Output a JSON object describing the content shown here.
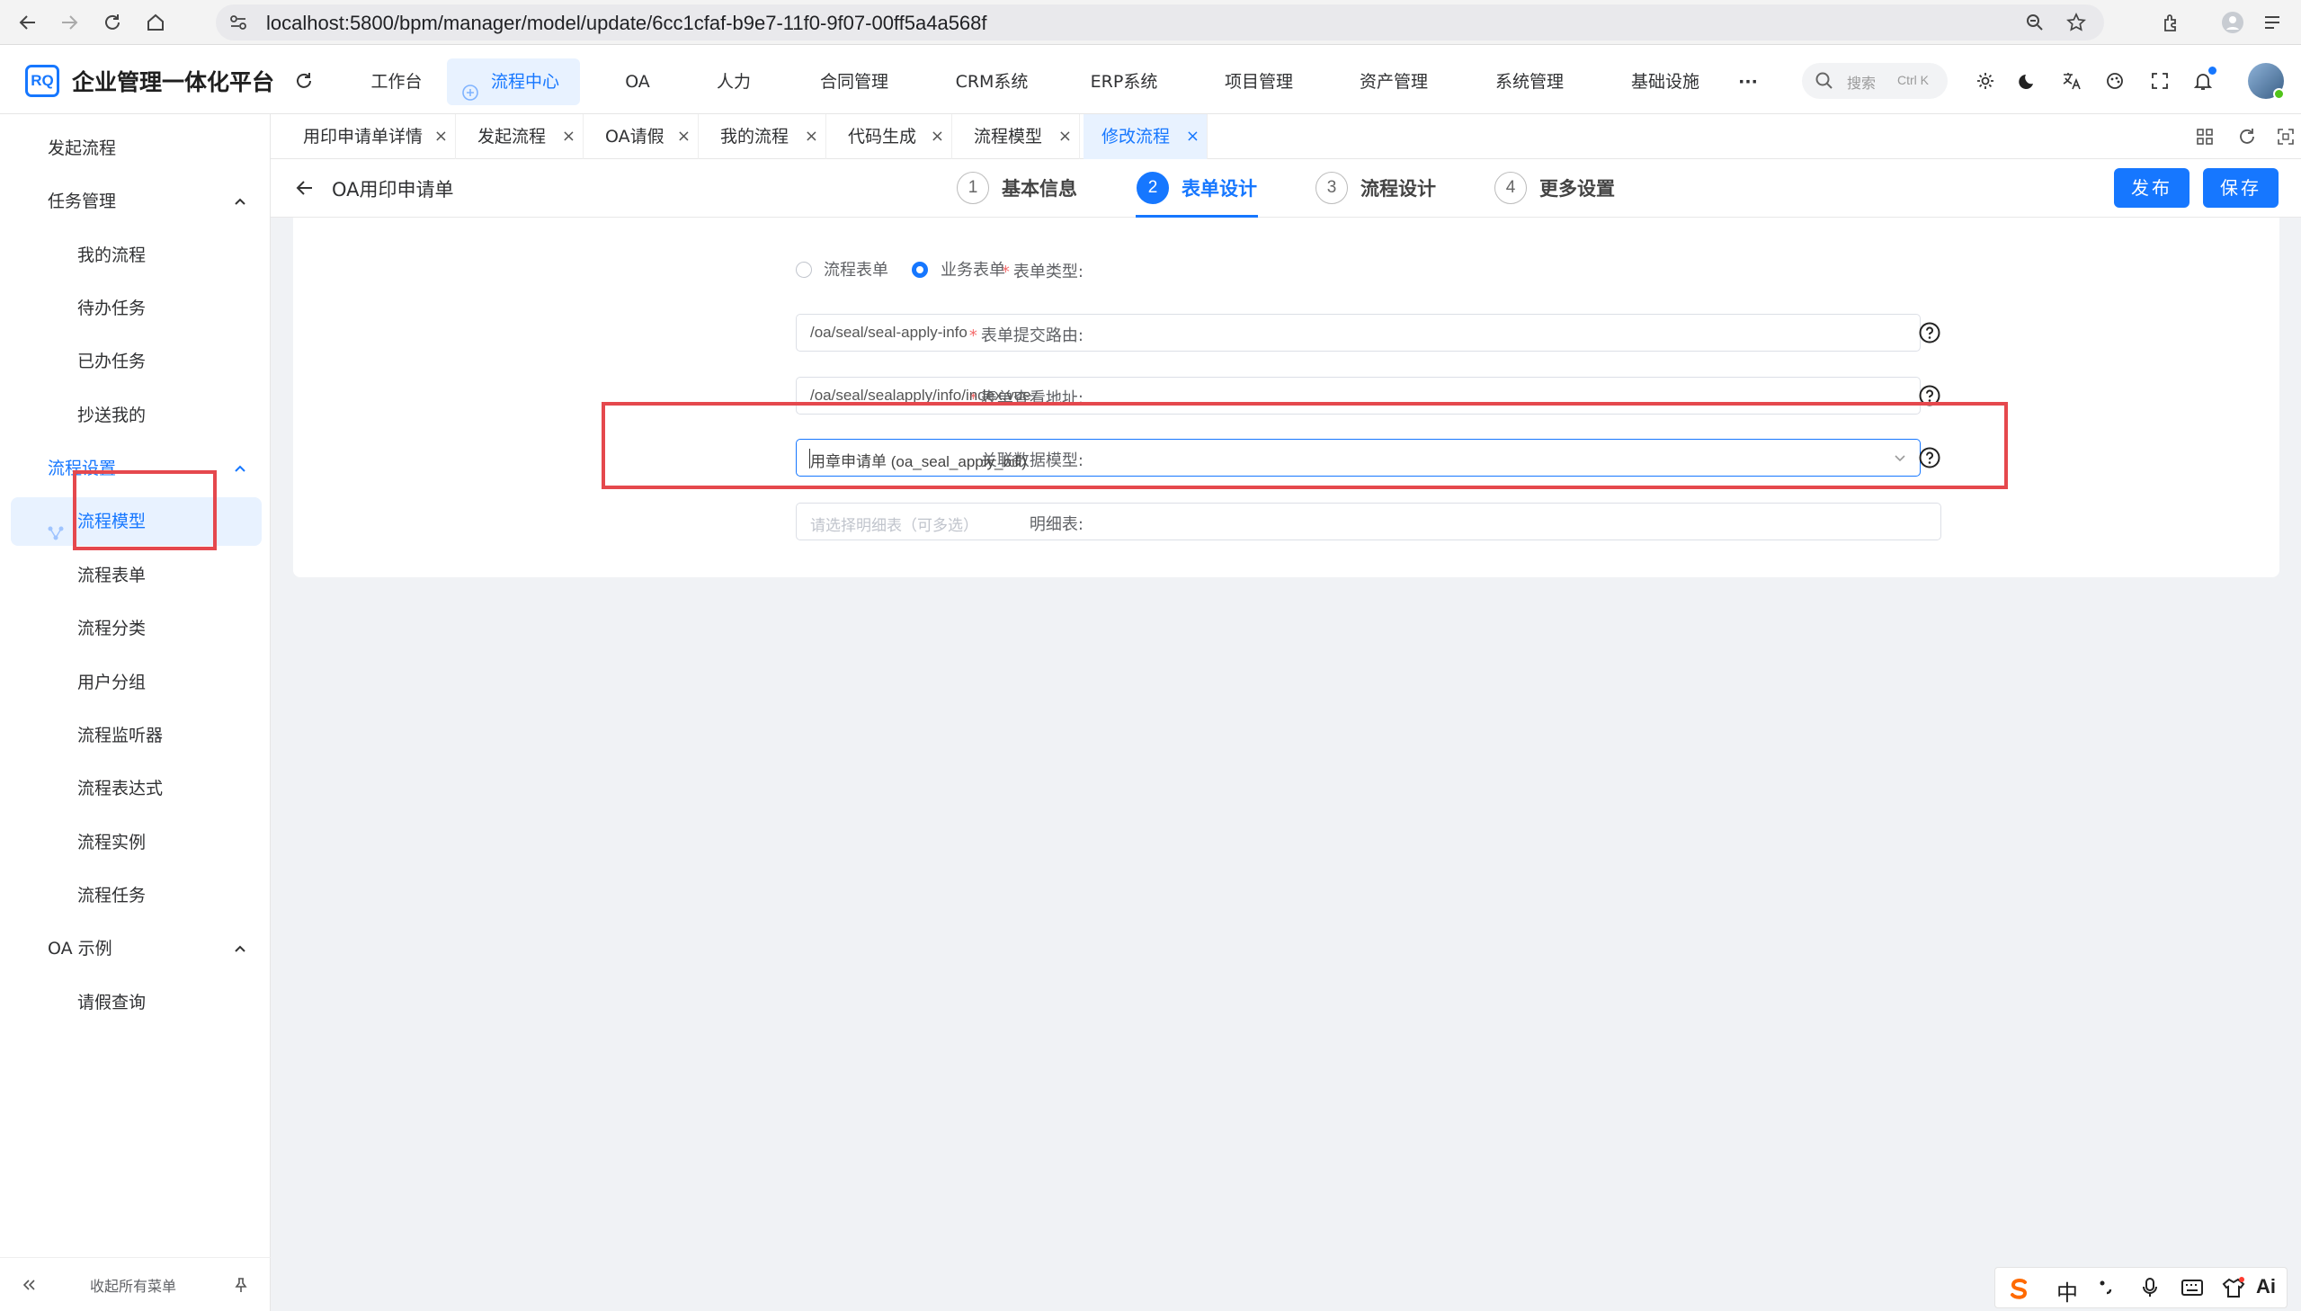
{
  "browser": {
    "url": "localhost:5800/bpm/manager/model/update/6cc1cfaf-b9e7-11f0-9f07-00ff5a4a568f"
  },
  "app": {
    "logo_text": "RQ",
    "title": "企业管理一体化平台",
    "nav": [
      "工作台",
      "流程中心",
      "OA",
      "人力",
      "合同管理",
      "CRM系统",
      "ERP系统",
      "项目管理",
      "资产管理",
      "系统管理",
      "基础设施",
      "···"
    ],
    "active_nav": "流程中心",
    "search_placeholder": "搜索",
    "search_shortcut": "Ctrl K"
  },
  "sidebar": {
    "items": [
      {
        "label": "发起流程"
      },
      {
        "label": "任务管理"
      },
      {
        "label": "我的流程"
      },
      {
        "label": "待办任务"
      },
      {
        "label": "已办任务"
      },
      {
        "label": "抄送我的"
      },
      {
        "label": "流程设置"
      },
      {
        "label": "流程模型"
      },
      {
        "label": "流程表单"
      },
      {
        "label": "流程分类"
      },
      {
        "label": "用户分组"
      },
      {
        "label": "流程监听器"
      },
      {
        "label": "流程表达式"
      },
      {
        "label": "流程实例"
      },
      {
        "label": "流程任务"
      },
      {
        "label": "OA 示例"
      },
      {
        "label": "请假查询"
      }
    ],
    "collapse_label": "收起所有菜单"
  },
  "tabs": [
    {
      "label": "用印申请单详情"
    },
    {
      "label": "发起流程"
    },
    {
      "label": "OA请假"
    },
    {
      "label": "我的流程"
    },
    {
      "label": "代码生成"
    },
    {
      "label": "流程模型"
    },
    {
      "label": "修改流程"
    }
  ],
  "page": {
    "title": "OA用印申请单",
    "steps": [
      {
        "num": "1",
        "label": "基本信息"
      },
      {
        "num": "2",
        "label": "表单设计"
      },
      {
        "num": "3",
        "label": "流程设计"
      },
      {
        "num": "4",
        "label": "更多设置"
      }
    ],
    "publish_label": "发布",
    "save_label": "保存"
  },
  "form": {
    "form_type_label": "表单类型:",
    "form_type_options": [
      "流程表单",
      "业务表单"
    ],
    "form_type_selected": "业务表单",
    "submit_route_label": "表单提交路由:",
    "submit_route_value": "/oa/seal/seal-apply-info",
    "view_addr_label": "表单查看地址:",
    "view_addr_value": "/oa/seal/sealapply/info/index.vue",
    "data_model_label": "关联数据模型:",
    "data_model_value": "用章申请单 (oa_seal_apply_bill)",
    "detail_label": "明细表:",
    "detail_placeholder": "请选择明细表（可多选）"
  },
  "ime": {
    "lang_label": "中"
  },
  "colors": {
    "primary": "#1677ff",
    "highlight_box": "#e5484d",
    "required": "#f56c6c"
  }
}
